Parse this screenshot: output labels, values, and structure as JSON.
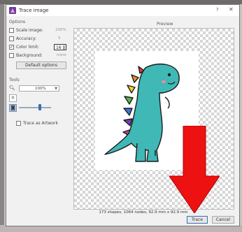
{
  "window": {
    "title": "Trace image",
    "help_glyph": "?",
    "close_glyph": "✕"
  },
  "options": {
    "section_label": "Options",
    "rows": [
      {
        "label": "Scale image:",
        "value": "100%",
        "checked": false
      },
      {
        "label": "Accuracy:",
        "value": "5",
        "checked": false
      },
      {
        "label": "Color limit:",
        "value": "16",
        "checked": true
      },
      {
        "label": "Background:",
        "value": "none",
        "checked": false
      }
    ],
    "default_button": "Default options"
  },
  "tools": {
    "section_label": "Tools",
    "zoom_value": "100%",
    "threshold_level": 0.65
  },
  "trace_as_artwork_label": "Trace as Artwork",
  "preview": {
    "label": "Preview",
    "status": "173 shapes, 1064 nodes, 92.9 mm x 92.9 mm"
  },
  "footer": {
    "trace_button": "Trace",
    "cancel_button": "Cancel"
  },
  "colors": {
    "dino_body": "#3fb8b6",
    "arrow_red": "#ee1111",
    "accent_blue": "#3a6fb0"
  }
}
